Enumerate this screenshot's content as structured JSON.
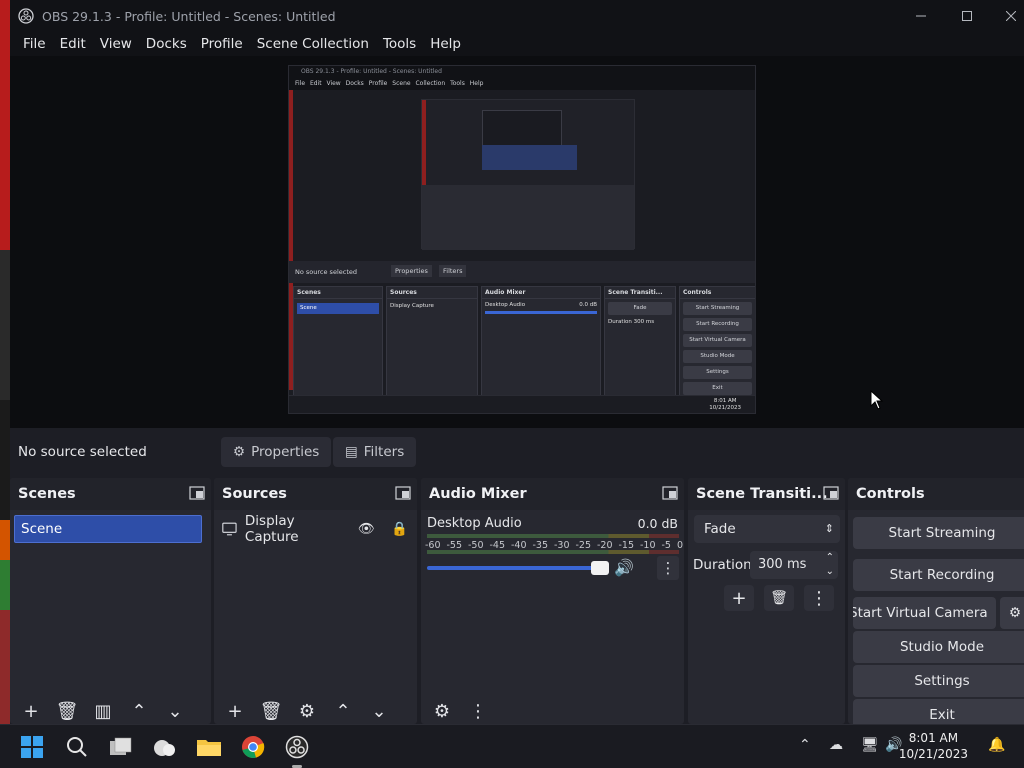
{
  "window": {
    "title": "OBS 29.1.3 - Profile: Untitled - Scenes: Untitled"
  },
  "menu": [
    "File",
    "Edit",
    "View",
    "Docks",
    "Profile",
    "Scene Collection",
    "Tools",
    "Help"
  ],
  "preview_mini": {
    "title": "OBS 29.1.3 - Profile: Untitled - Scenes: Untitled",
    "menu": "File Edit View Docks Profile Scene Collection Tools Help",
    "no_source": "No source selected",
    "properties": "Properties",
    "filters": "Filters",
    "scenes": "Scenes",
    "scene": "Scene",
    "sources": "Sources",
    "display_capture": "Display Capture",
    "audio_mixer": "Audio Mixer",
    "desktop_audio": "Desktop Audio",
    "db": "0.0 dB",
    "scene_transitions": "Scene Transiti...",
    "fade": "Fade",
    "duration": "Duration",
    "duration_value": "300 ms",
    "controls": "Controls",
    "start_streaming": "Start Streaming",
    "start_recording": "Start Recording",
    "start_virtual": "Start Virtual Camera",
    "studio_mode": "Studio Mode",
    "settings": "Settings",
    "exit": "Exit",
    "time": "8:01 AM",
    "date": "10/21/2023"
  },
  "source_row": {
    "no_source": "No source selected",
    "properties": "Properties",
    "filters": "Filters"
  },
  "scenes": {
    "title": "Scenes",
    "items": [
      "Scene"
    ]
  },
  "sources": {
    "title": "Sources",
    "items": [
      "Display Capture"
    ]
  },
  "mixer": {
    "title": "Audio Mixer",
    "channel": "Desktop Audio",
    "level": "0.0 dB",
    "scale": [
      "-60",
      "-55",
      "-50",
      "-45",
      "-40",
      "-35",
      "-30",
      "-25",
      "-20",
      "-15",
      "-10",
      "-5",
      "0"
    ]
  },
  "transitions": {
    "title": "Scene Transiti...",
    "selected": "Fade",
    "duration_label": "Duration",
    "duration_value": "300 ms"
  },
  "controls": {
    "title": "Controls",
    "start_streaming": "Start Streaming",
    "start_recording": "Start Recording",
    "start_virtual_camera": "Start Virtual Camera",
    "studio_mode": "Studio Mode",
    "settings": "Settings",
    "exit": "Exit"
  },
  "taskbar": {
    "time": "8:01 AM",
    "date": "10/21/2023"
  },
  "colors": {
    "selection": "#2e4ea8",
    "volume": "#3a66d4",
    "background": "#1d1e25"
  }
}
